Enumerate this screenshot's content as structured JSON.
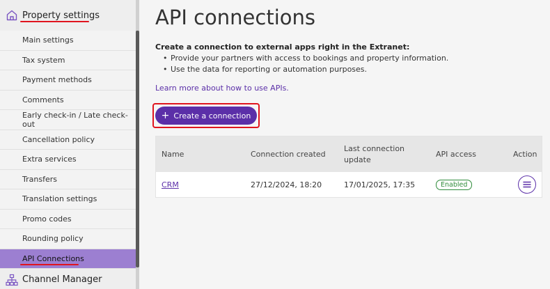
{
  "sidebar": {
    "header": {
      "label": "Property settings",
      "icon": "home-icon"
    },
    "items": [
      {
        "label": "Main settings"
      },
      {
        "label": "Tax system"
      },
      {
        "label": "Payment methods"
      },
      {
        "label": "Comments"
      },
      {
        "label": "Early check-in / Late check-out"
      },
      {
        "label": "Cancellation policy"
      },
      {
        "label": "Extra services"
      },
      {
        "label": "Transfers"
      },
      {
        "label": "Translation settings"
      },
      {
        "label": "Promo codes"
      },
      {
        "label": "Rounding policy"
      },
      {
        "label": "API Connections",
        "active": true
      }
    ],
    "bottom": {
      "label": "Channel Manager",
      "icon": "sitemap-icon"
    }
  },
  "main": {
    "title": "API connections",
    "intro": "Create a connection to external apps right in the Extranet:",
    "bullets": [
      "Provide your partners with access to bookings and property information.",
      "Use the data for reporting or automation purposes."
    ],
    "learn_link": "Learn more about how to use APIs.",
    "create_button": {
      "plus": "+",
      "label": "Create a connection"
    }
  },
  "table": {
    "headers": {
      "name": "Name",
      "created": "Connection created",
      "last_update_1": "Last connection",
      "last_update_2": "update",
      "api_access": "API access",
      "action": "Action"
    },
    "rows": [
      {
        "name": "CRM",
        "created": "27/12/2024, 18:20",
        "last_update": "17/01/2025, 17:35",
        "api_access": "Enabled"
      }
    ]
  },
  "colors": {
    "accent": "#5b2fa8",
    "active_item": "#9c7fd1",
    "highlight": "#e0141e",
    "enabled": "#2e8b3a"
  }
}
